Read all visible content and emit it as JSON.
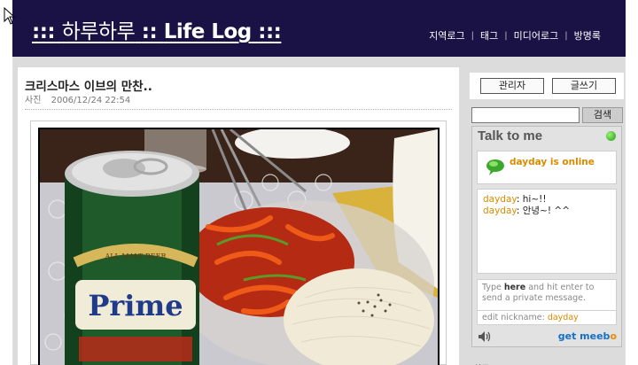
{
  "header": {
    "title_korean": "하루하루",
    "title_prefix": ":::",
    "title_mid": "::",
    "title_english": "Life Log",
    "title_suffix": ":::",
    "nav": [
      "지역로그",
      "태그",
      "미디어로그",
      "방명록"
    ]
  },
  "post": {
    "title": "크리스마스 이브의 만찬..",
    "category": "사진",
    "datetime": "2006/12/24 22:54",
    "photo": {
      "can_text": "Prime",
      "can_sub": "ALL MALT BEER"
    }
  },
  "sidebar": {
    "admin_label": "관리자",
    "write_label": "글쓰기",
    "search_value": "",
    "search_label": "검색",
    "meebo": {
      "title": "Talk to me",
      "status": "dayday is online",
      "chat": [
        {
          "who": "dayday",
          "msg": " hi~!!"
        },
        {
          "who": "dayday",
          "msg": " 안녕~! ^^"
        }
      ],
      "input_hint_pre": "Type ",
      "input_hint_bold": "here",
      "input_hint_post": " and hit enter to send a private message.",
      "nick_label": "edit nickname: ",
      "nick_value": "dayday",
      "logo_main": "get meeb",
      "logo_o": "o"
    },
    "next_heading": "최근"
  },
  "colors": {
    "header_bg": "#1a1144",
    "status_orange": "#d98a00",
    "meebo_blue": "#1470c8"
  }
}
